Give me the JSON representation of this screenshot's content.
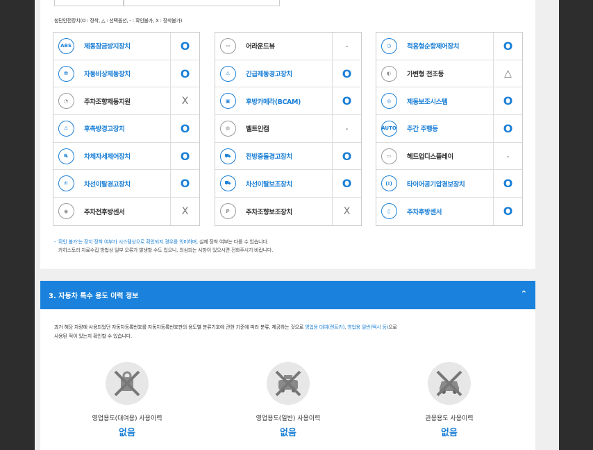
{
  "legend": "첨단안전장치(O : 장착, △ : 선택옵션, - : 확인불가, X : 장착불가)",
  "columns": [
    [
      {
        "icon": "abs-icon",
        "glyph": "ABS",
        "label": "제동잠금방지장치",
        "value": "O",
        "active": true
      },
      {
        "icon": "emergency-brake-icon",
        "glyph": "⛃",
        "label": "자동비상제동장치",
        "value": "O",
        "active": true
      },
      {
        "icon": "parking-steer-icon",
        "glyph": "◔",
        "label": "주차조향제동지원",
        "value": "X",
        "active": false
      },
      {
        "icon": "rear-side-warning-icon",
        "glyph": "⚠",
        "label": "후측방경고장치",
        "value": "O",
        "active": true
      },
      {
        "icon": "stability-control-icon",
        "glyph": "⛐",
        "label": "차체자세제어장치",
        "value": "O",
        "active": true
      },
      {
        "icon": "lane-departure-icon",
        "glyph": "⛙",
        "label": "차선이탈경고장치",
        "value": "O",
        "active": true
      },
      {
        "icon": "front-parking-sensor-icon",
        "glyph": "◉",
        "label": "주차전후방센서",
        "value": "X",
        "active": false
      }
    ],
    [
      {
        "icon": "around-view-icon",
        "glyph": "▭",
        "label": "어라운드뷰",
        "value": "-",
        "active": false
      },
      {
        "icon": "emergency-brake-warning-icon",
        "glyph": "⚠",
        "label": "긴급제동경고장치",
        "value": "O",
        "active": true
      },
      {
        "icon": "rear-camera-icon",
        "glyph": "▣",
        "label": "후방카메라(BCAM)",
        "value": "O",
        "active": true
      },
      {
        "icon": "belt-reminder-icon",
        "glyph": "◍",
        "label": "벨트인캠",
        "value": "-",
        "active": false
      },
      {
        "icon": "forward-collision-icon",
        "glyph": "⛟",
        "label": "전방충돌경고장치",
        "value": "O",
        "active": true
      },
      {
        "icon": "lane-keeping-icon",
        "glyph": "⛟",
        "label": "차선이탈보조장치",
        "value": "O",
        "active": true
      },
      {
        "icon": "parking-assist-icon",
        "glyph": "P",
        "label": "주차조향보조장치",
        "value": "X",
        "active": false
      }
    ],
    [
      {
        "icon": "adaptive-cruise-icon",
        "glyph": "◷",
        "label": "적응형순항제어장치",
        "value": "O",
        "active": true
      },
      {
        "icon": "adaptive-headlight-icon",
        "glyph": "◐",
        "label": "가변형 전조등",
        "value": "△",
        "active": false
      },
      {
        "icon": "brake-assist-icon",
        "glyph": "◎",
        "label": "제동보조시스템",
        "value": "O",
        "active": true
      },
      {
        "icon": "drl-icon",
        "glyph": "AUTO",
        "label": "주간 주행등",
        "value": "O",
        "active": true
      },
      {
        "icon": "hud-icon",
        "glyph": "▭",
        "label": "헤드업디스플레이",
        "value": "-",
        "active": false
      },
      {
        "icon": "tpms-icon",
        "glyph": "(!)",
        "label": "타이어공기압경보장치",
        "value": "O",
        "active": true
      },
      {
        "icon": "rear-parking-sensor-icon",
        "glyph": "▯",
        "label": "주차후방센서",
        "value": "O",
        "active": true
      }
    ]
  ],
  "notes": {
    "line1_highlight": "- '확인 불가'는 장치 장착 여부가 시스템상으로 확인되지 경우를 의미하며,",
    "line1_rest": " 실제 장착 여부는 다를 수 있습니다.",
    "line2": "카히스토리 자료수집 방법상 일부 오류가 발생할 수도 있으니, 의심되는 사항이 있으시면 전화주시기 바랍니다."
  },
  "section": {
    "title": "3. 자동차 특수 용도 이력 정보",
    "chevron": "⌃"
  },
  "description": {
    "part1": "과거 해당 차량에 사용되었던 자동차등록번호를 자동차등록번호판의 용도별 분류기호에 관한 기준에 따라 분류, 제공하는 것으로 ",
    "hl1": "영업용 대여(렌트카)",
    "part2": ", ",
    "hl2": "영업용 일반(택시 등)",
    "part3": "으로",
    "line2": "사용된 적이 있는지 확인할 수 있습니다."
  },
  "usages": [
    {
      "icon": "rental-car-icon",
      "label": "영업용도(대여용) 사용이력",
      "value": "없음"
    },
    {
      "icon": "taxi-icon",
      "label": "영업용도(일반) 사용이력",
      "value": "없음"
    },
    {
      "icon": "government-car-icon",
      "label": "관용용도 사용이력",
      "value": "없음"
    }
  ],
  "colors": {
    "accent": "#1a82dc",
    "active": "#1a7fd6"
  }
}
